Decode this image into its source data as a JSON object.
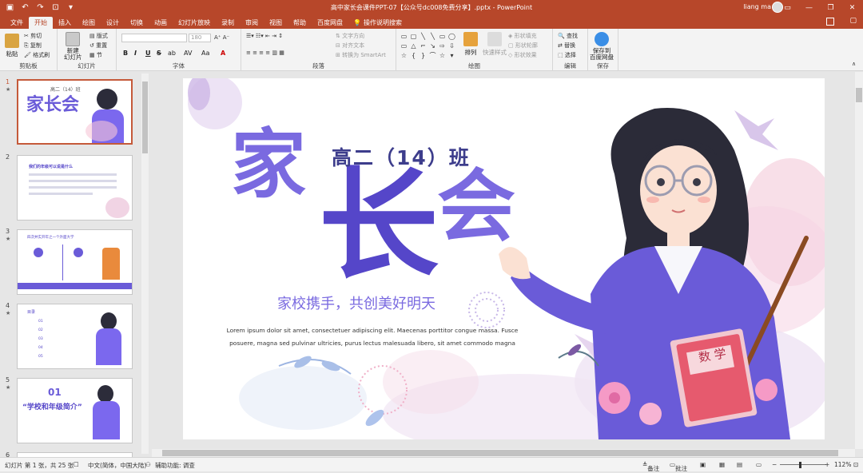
{
  "window": {
    "title": "高中家长会课件PPT-07【公众号dc008免费分享】.pptx - PowerPoint",
    "user": "liang ma"
  },
  "tabs": [
    {
      "label": "文件"
    },
    {
      "label": "开始"
    },
    {
      "label": "插入"
    },
    {
      "label": "绘图"
    },
    {
      "label": "设计"
    },
    {
      "label": "切换"
    },
    {
      "label": "动画"
    },
    {
      "label": "幻灯片放映"
    },
    {
      "label": "录制"
    },
    {
      "label": "审阅"
    },
    {
      "label": "视图"
    },
    {
      "label": "帮助"
    },
    {
      "label": "百度网盘"
    }
  ],
  "tell_me": "操作说明搜索",
  "ribbon": {
    "clipboard": {
      "label": "剪贴板",
      "paste": "粘贴",
      "cut": "剪切",
      "copy": "复制",
      "format_painter": "格式刷"
    },
    "slides": {
      "label": "幻灯片",
      "new_slide": "新建\n幻灯片",
      "reuse": "重用\n幻灯片",
      "layout": "版式",
      "reset": "重置",
      "section": "节"
    },
    "font": {
      "label": "字体",
      "size": "180",
      "bold": "B",
      "italic": "I",
      "underline": "U",
      "strike": "S",
      "shadow": "ab",
      "spacing": "AV",
      "case": "Aa",
      "color": "A"
    },
    "paragraph": {
      "label": "段落",
      "text_direction": "文字方向",
      "align_text": "对齐文本",
      "smartart": "转换为 SmartArt"
    },
    "drawing": {
      "label": "绘图",
      "arrange": "排列",
      "quick_styles": "快速样式",
      "shape_fill": "形状填充",
      "shape_outline": "形状轮廓",
      "shape_effects": "形状效果"
    },
    "editing": {
      "label": "编辑",
      "find": "查找",
      "replace": "替换",
      "select": "选择"
    },
    "save": {
      "label": "保存",
      "save_to_baidu": "保存到\n百度网盘"
    }
  },
  "thumbnails": [
    {
      "num": "1",
      "title_main": "家长会",
      "title_sub": "高二（14）班"
    },
    {
      "num": "2",
      "heading": "我们的年级可以说是什么"
    },
    {
      "num": "3",
      "heading": "四次并实开年之一个外面大学"
    },
    {
      "num": "4",
      "heading": "目录",
      "items": [
        "01",
        "02",
        "03",
        "04",
        "05"
      ]
    },
    {
      "num": "5",
      "section_num": "01",
      "section_title": "“学校和年级简介”"
    },
    {
      "num": "6"
    }
  ],
  "slide": {
    "class_title": "高二（14）班",
    "main_title_1": "家",
    "main_title_2": "长",
    "main_title_3": "会",
    "subtitle": "家校携手，共创美好明天",
    "body_line1": "Lorem ipsum dolor sit amet, consectetuer adipiscing elit. Maecenas porttitor congue massa. Fusce",
    "body_line2": "posuere, magna sed pulvinar ultricies, purus lectus malesuada libero, sit amet commodo magna",
    "book_label": "数 学"
  },
  "status": {
    "slide_info": "幻灯片 第 1 张，共 25 张",
    "language": "中文(简体，中国大陆)",
    "accessibility": "辅助功能: 调查",
    "notes": "备注",
    "comments": "批注",
    "zoom": "112%"
  },
  "colors": {
    "accent": "#b7472a",
    "title_purple": "#6a5bd8",
    "title_purple_dark": "#5546c9"
  }
}
